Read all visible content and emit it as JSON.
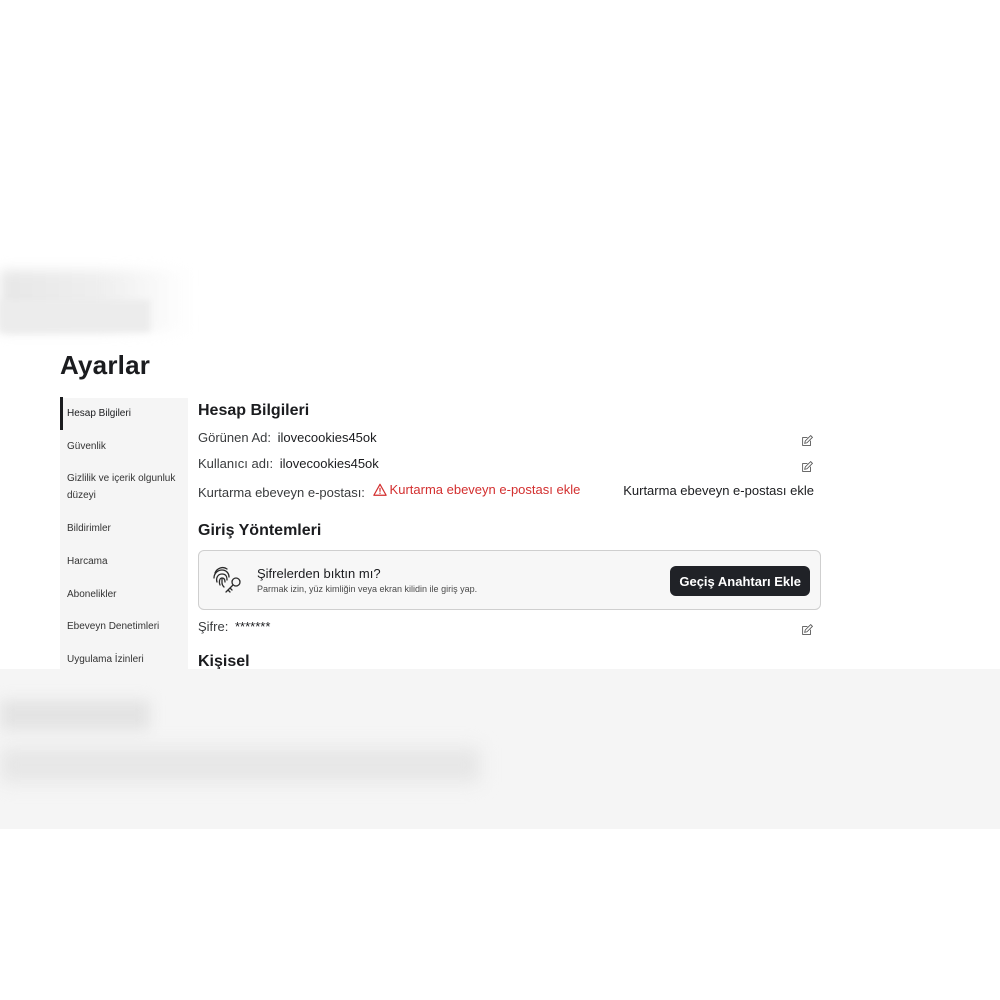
{
  "page": {
    "title": "Ayarlar"
  },
  "sidebar": {
    "items": [
      {
        "label": "Hesap Bilgileri"
      },
      {
        "label": "Güvenlik"
      },
      {
        "label": "Gizlilik ve içerik olgunluk düzeyi"
      },
      {
        "label": "Bildirimler"
      },
      {
        "label": "Harcama"
      },
      {
        "label": "Abonelikler"
      },
      {
        "label": "Ebeveyn Denetimleri"
      },
      {
        "label": "Uygulama İzinleri"
      }
    ]
  },
  "account": {
    "section_title": "Hesap Bilgileri",
    "display_name_label": "Görünen Ad:",
    "display_name_value": "ilovecookies45ok",
    "username_label": "Kullanıcı adı:",
    "username_value": "ilovecookies45ok",
    "recovery_label": "Kurtarma ebeveyn e-postası:",
    "recovery_warning": "Kurtarma ebeveyn e-postası ekle",
    "recovery_action": "Kurtarma ebeveyn e-postası ekle"
  },
  "login_methods": {
    "section_title": "Giriş Yöntemleri",
    "passkey_title": "Şifrelerden bıktın mı?",
    "passkey_subtitle": "Parmak izin, yüz kimliğin veya ekran kilidin ile giriş yap.",
    "passkey_button": "Geçiş Anahtarı Ekle",
    "password_label": "Şifre:",
    "password_value": "*******"
  },
  "personal": {
    "section_title": "Kişisel"
  },
  "colors": {
    "accent_dark": "#202227",
    "warning": "#d32f2f",
    "sidebar_bg": "#f5f5f5"
  },
  "icons": [
    "edit-icon",
    "warning-icon",
    "fingerprint-key-icon"
  ]
}
